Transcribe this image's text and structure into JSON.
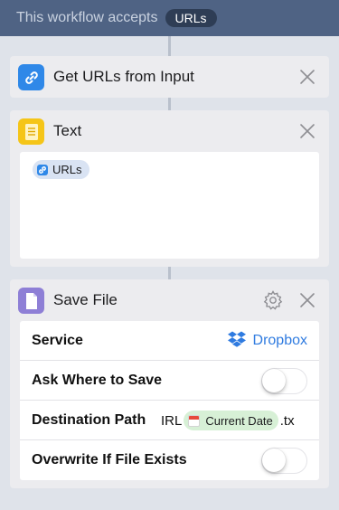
{
  "header": {
    "text": "This workflow accepts",
    "pill": "URLs"
  },
  "actions": [
    {
      "title": "Get URLs from Input",
      "icon": "link-icon",
      "icon_color": "#2f88e8"
    },
    {
      "title": "Text",
      "icon": "note-icon",
      "icon_color": "#f5c518",
      "tokens": [
        {
          "label": "URLs",
          "icon": "link-icon"
        }
      ]
    },
    {
      "title": "Save File",
      "icon": "document-icon",
      "icon_color": "#8e7fd6",
      "params": {
        "service_label": "Service",
        "service_value": "Dropbox",
        "ask_label": "Ask Where to Save",
        "ask_value": false,
        "dest_label": "Destination Path",
        "dest_prefix": "IRL",
        "dest_token": "Current Date",
        "dest_suffix": ".tx",
        "overwrite_label": "Overwrite If File Exists",
        "overwrite_value": false
      }
    }
  ],
  "colors": {
    "header_bg": "#4f6384",
    "accent_blue": "#2f7be0",
    "token_blue_bg": "#d9e3f3",
    "token_green_bg": "#d7f0d6"
  }
}
